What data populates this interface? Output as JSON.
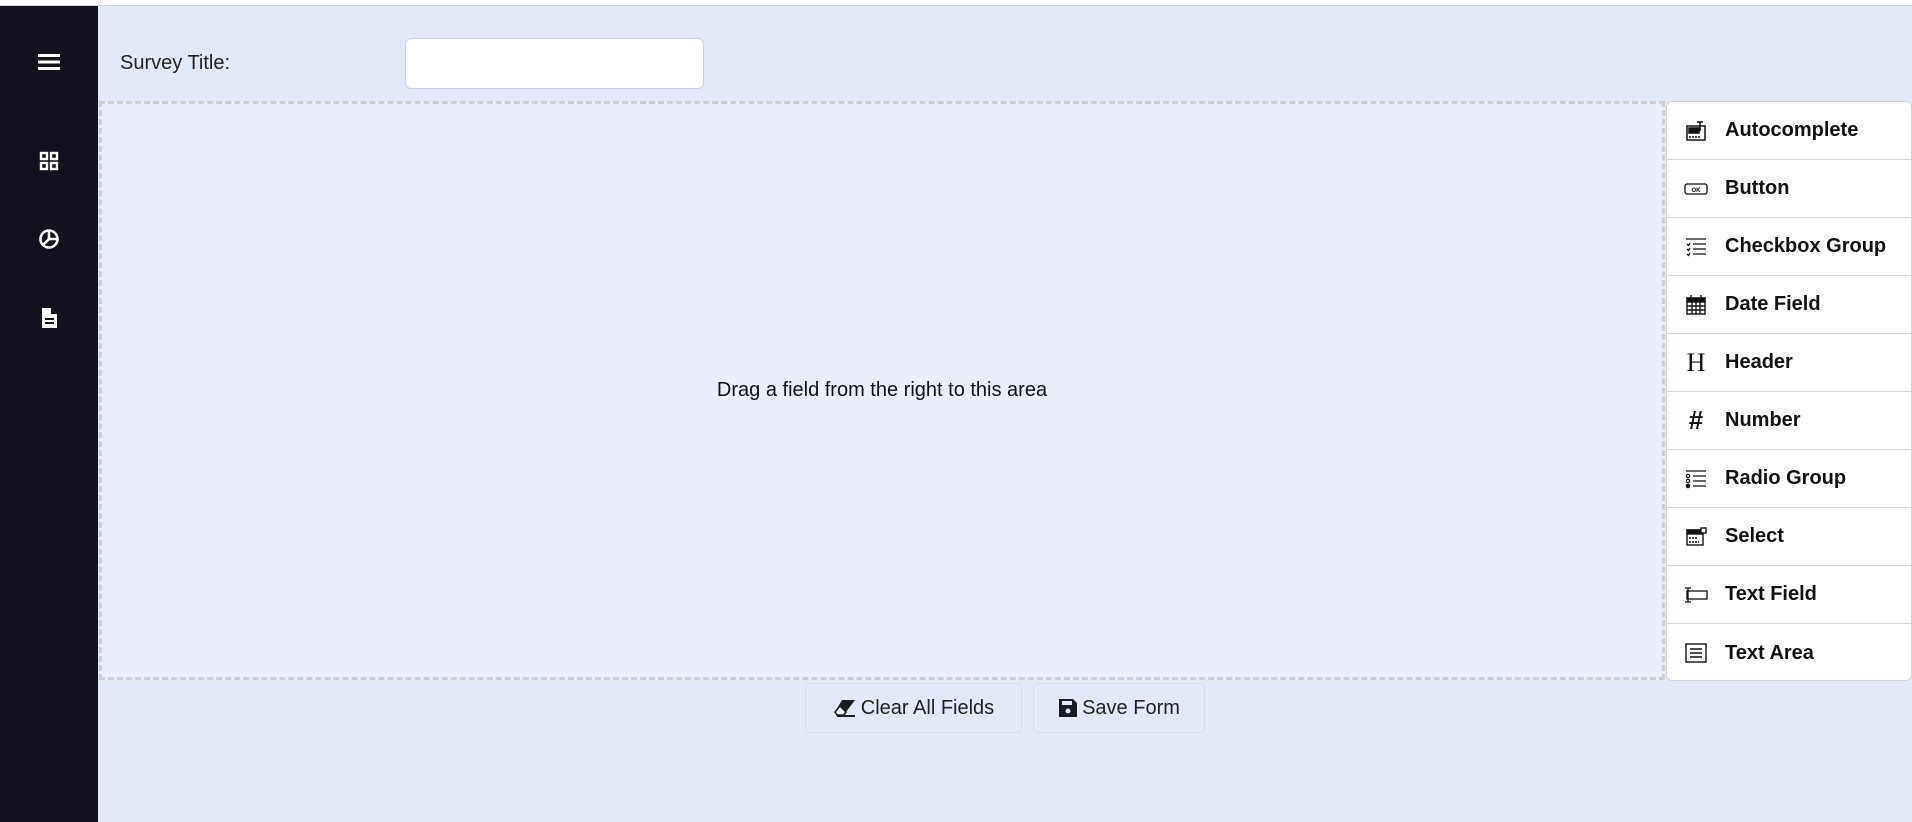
{
  "header": {
    "survey_title_label": "Survey Title:",
    "survey_title_value": "",
    "survey_title_placeholder": ""
  },
  "sidebar": {
    "items": [
      {
        "icon": "menu-icon"
      },
      {
        "icon": "dashboard-grid-icon"
      },
      {
        "icon": "pie-chart-icon"
      },
      {
        "icon": "document-icon"
      }
    ]
  },
  "dropzone": {
    "hint": "Drag a field from the right to this area"
  },
  "palette": {
    "items": [
      {
        "label": "Autocomplete",
        "icon": "autocomplete-icon"
      },
      {
        "label": "Button",
        "icon": "button-ok-icon"
      },
      {
        "label": "Checkbox Group",
        "icon": "checkbox-list-icon"
      },
      {
        "label": "Date Field",
        "icon": "calendar-icon"
      },
      {
        "label": "Header",
        "icon": "header-h-icon"
      },
      {
        "label": "Number",
        "icon": "hash-icon"
      },
      {
        "label": "Radio Group",
        "icon": "radio-list-icon"
      },
      {
        "label": "Select",
        "icon": "select-icon"
      },
      {
        "label": "Text Field",
        "icon": "text-field-icon"
      },
      {
        "label": "Text Area",
        "icon": "text-area-icon"
      }
    ]
  },
  "actions": {
    "clear_label": "Clear All Fields",
    "save_label": "Save Form"
  },
  "colors": {
    "sidebar": "#11121d",
    "background": "#e2e8f5",
    "dropzone": "#e9eef8"
  }
}
